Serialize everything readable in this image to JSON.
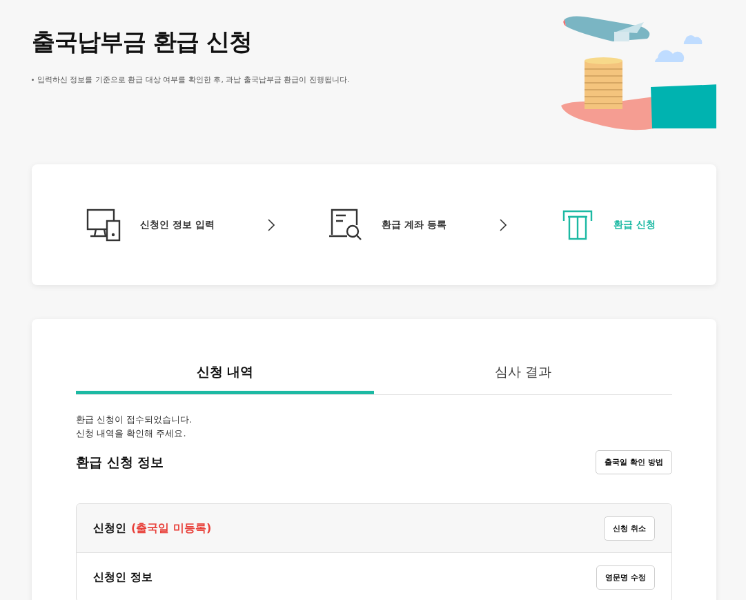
{
  "header": {
    "title": "출국납부금 환급 신청",
    "note": "입력하신 정보를 기준으로 환급 대상 여부를 확인한 후, 과납 출국납부금 환급이 진행됩니다."
  },
  "steps": [
    {
      "kind": "devices",
      "label": "신청인 정보 입력",
      "selected": false
    },
    {
      "kind": "document",
      "label": "환급 계좌 등록",
      "selected": false
    },
    {
      "kind": "atm",
      "label": "환급 신청",
      "selected": true
    }
  ],
  "tabs": [
    {
      "label": "신청 내역",
      "selected": true
    },
    {
      "label": "심사 결과",
      "selected": false
    }
  ],
  "message": [
    "환급 신청이 접수되었습니다.",
    "신청 내역을 확인해 주세요."
  ],
  "section": {
    "title": "환급 신청 정보",
    "button": "출국일 확인 방법"
  },
  "applicant": {
    "label": "신청인",
    "status": "(출국일 미등록)",
    "button": "신청 취소"
  },
  "info_row": {
    "label": "신청인 정보",
    "button": "영문명 수정"
  }
}
